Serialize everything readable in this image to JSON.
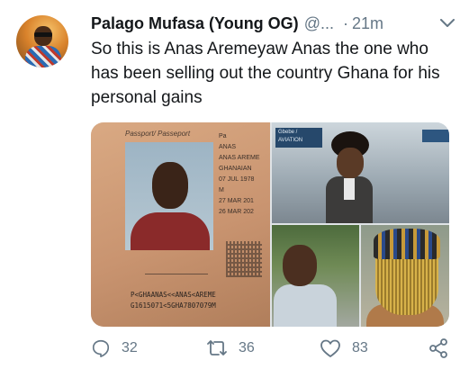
{
  "tweet": {
    "display_name": "Palago Mufasa (Young OG)",
    "handle": "@...",
    "separator": "·",
    "time": "21m",
    "text": "So this is Anas Aremeyaw Anas the one who has been selling out the country Ghana for his personal gains"
  },
  "media": {
    "passport": {
      "header": "Passport/ Passeport",
      "fields": [
        "Pa",
        "ANAS",
        "ANAS AREME",
        "GHANAIAN",
        "07 JUL 1978",
        "M",
        "27 MAR 201",
        "26 MAR 202"
      ],
      "mrz_line_1": "P<GHAANAS<<ANAS<AREME",
      "mrz_line_2": "G1615071<5GHA7807079M"
    },
    "station_sign": "Gbebe / AVIATION"
  },
  "actions": {
    "reply_count": "32",
    "retweet_count": "36",
    "like_count": "83"
  },
  "icons": [
    "reply-icon",
    "retweet-icon",
    "like-icon",
    "share-icon",
    "chevron-down-icon"
  ],
  "colors": {
    "secondary_text": "#657786",
    "primary_text": "#14171a"
  }
}
